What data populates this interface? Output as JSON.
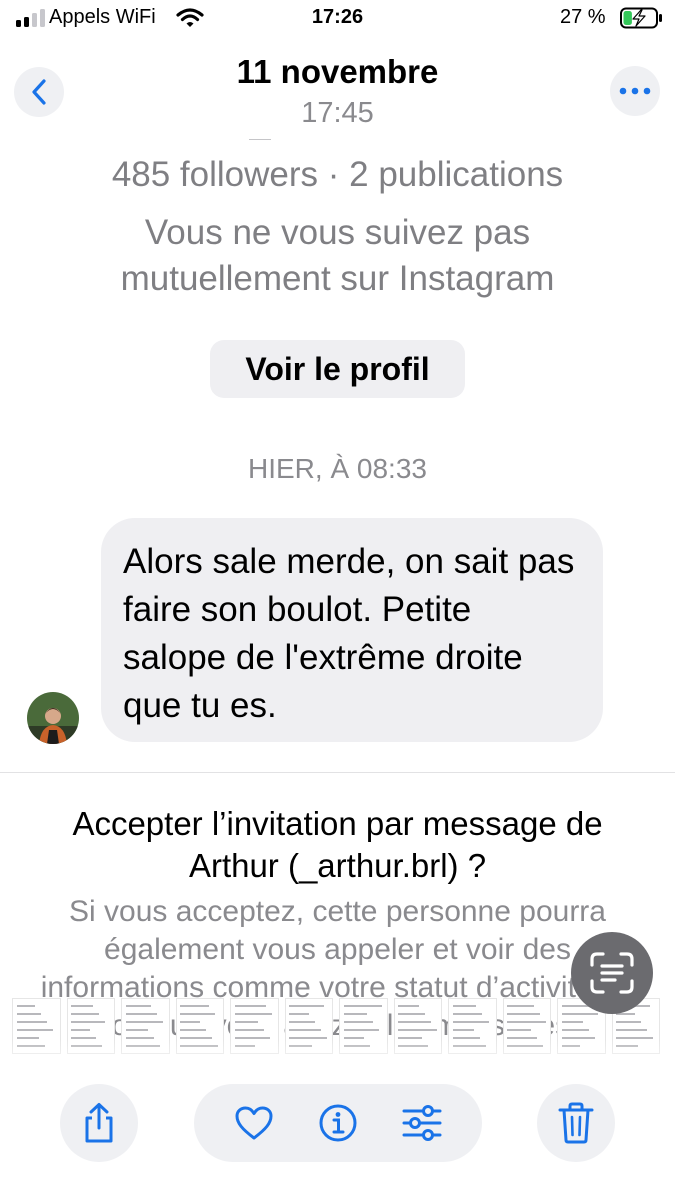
{
  "status_bar": {
    "carrier": "Appels WiFi",
    "time": "17:26",
    "battery_percent": "27 %",
    "signal_bars_active": 2,
    "signal_bars_total": 4,
    "battery_level": 0.27
  },
  "header": {
    "title": "11 novembre",
    "subtitle": "17:45"
  },
  "chat": {
    "profile_stats": "485 followers · 2 publications",
    "not_mutual": "Vous ne vous suivez pas mutuellement sur Instagram",
    "view_profile_label": "Voir le profil",
    "message_timestamp": "HIER, À 08:33",
    "message_text": "Alors sale merde, on sait pas faire son boulot. Petite salope de l'extrême droite que tu es."
  },
  "invitation": {
    "title": "Accepter l’invitation par message de Arthur (_arthur.brl) ?",
    "description": "Si vous acceptez, cette personne pourra également vous appeler et voir des informations comme votre statut d’activité ou lorsque vous avez lu les messages"
  },
  "thumbnail_count": 12,
  "colors": {
    "accent": "#1a73e8",
    "bubble": "#efeff2",
    "secondary_text": "#8a8a8e",
    "battery_green": "#34c759"
  },
  "icons": {
    "back": "chevron-left-icon",
    "more": "ellipsis-icon",
    "share": "share-icon",
    "favorite": "heart-icon",
    "info": "info-icon",
    "adjust": "sliders-icon",
    "delete": "trash-icon",
    "live_text": "live-text-icon"
  }
}
